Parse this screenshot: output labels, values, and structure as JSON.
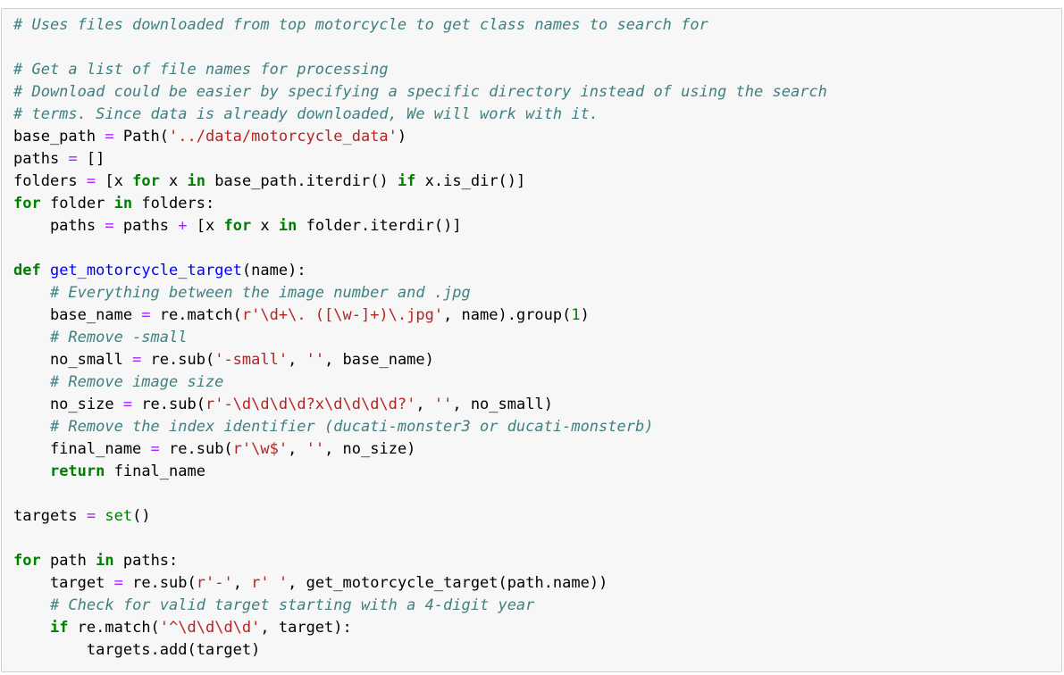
{
  "cell": {
    "lines": [
      [
        {
          "t": "cm",
          "v": "# Uses files downloaded from top motorcycle to get class names to search for"
        }
      ],
      [],
      [
        {
          "t": "cm",
          "v": "# Get a list of file names for processing"
        }
      ],
      [
        {
          "t": "cm",
          "v": "# Download could be easier by specifying a specific directory instead of using the search"
        }
      ],
      [
        {
          "t": "cm",
          "v": "# terms. Since data is already downloaded, We will work with it."
        }
      ],
      [
        {
          "t": "",
          "v": "base_path "
        },
        {
          "t": "op",
          "v": "="
        },
        {
          "t": "",
          "v": " Path("
        },
        {
          "t": "st",
          "v": "'../data/motorcycle_data'"
        },
        {
          "t": "",
          "v": ")"
        }
      ],
      [
        {
          "t": "",
          "v": "paths "
        },
        {
          "t": "op",
          "v": "="
        },
        {
          "t": "",
          "v": " []"
        }
      ],
      [
        {
          "t": "",
          "v": "folders "
        },
        {
          "t": "op",
          "v": "="
        },
        {
          "t": "",
          "v": " [x "
        },
        {
          "t": "kw",
          "v": "for"
        },
        {
          "t": "",
          "v": " x "
        },
        {
          "t": "kw",
          "v": "in"
        },
        {
          "t": "",
          "v": " base_path.iterdir() "
        },
        {
          "t": "kw",
          "v": "if"
        },
        {
          "t": "",
          "v": " x.is_dir()]"
        }
      ],
      [
        {
          "t": "kw",
          "v": "for"
        },
        {
          "t": "",
          "v": " folder "
        },
        {
          "t": "kw",
          "v": "in"
        },
        {
          "t": "",
          "v": " folders:"
        }
      ],
      [
        {
          "t": "",
          "v": "    paths "
        },
        {
          "t": "op",
          "v": "="
        },
        {
          "t": "",
          "v": " paths "
        },
        {
          "t": "op",
          "v": "+"
        },
        {
          "t": "",
          "v": " [x "
        },
        {
          "t": "kw",
          "v": "for"
        },
        {
          "t": "",
          "v": " x "
        },
        {
          "t": "kw",
          "v": "in"
        },
        {
          "t": "",
          "v": " folder.iterdir()]"
        }
      ],
      [],
      [
        {
          "t": "kw",
          "v": "def"
        },
        {
          "t": "",
          "v": " "
        },
        {
          "t": "fn",
          "v": "get_motorcycle_target"
        },
        {
          "t": "",
          "v": "(name):"
        }
      ],
      [
        {
          "t": "",
          "v": "    "
        },
        {
          "t": "cm",
          "v": "# Everything between the image number and .jpg"
        }
      ],
      [
        {
          "t": "",
          "v": "    base_name "
        },
        {
          "t": "op",
          "v": "="
        },
        {
          "t": "",
          "v": " re.match("
        },
        {
          "t": "st",
          "v": "r'\\d+\\. ([\\w-]+)\\.jpg'"
        },
        {
          "t": "",
          "v": ", name).group("
        },
        {
          "t": "nm",
          "v": "1"
        },
        {
          "t": "",
          "v": ")"
        }
      ],
      [
        {
          "t": "",
          "v": "    "
        },
        {
          "t": "cm",
          "v": "# Remove -small"
        }
      ],
      [
        {
          "t": "",
          "v": "    no_small "
        },
        {
          "t": "op",
          "v": "="
        },
        {
          "t": "",
          "v": " re.sub("
        },
        {
          "t": "st",
          "v": "'-small'"
        },
        {
          "t": "",
          "v": ", "
        },
        {
          "t": "st",
          "v": "''"
        },
        {
          "t": "",
          "v": ", base_name)"
        }
      ],
      [
        {
          "t": "",
          "v": "    "
        },
        {
          "t": "cm",
          "v": "# Remove image size"
        }
      ],
      [
        {
          "t": "",
          "v": "    no_size "
        },
        {
          "t": "op",
          "v": "="
        },
        {
          "t": "",
          "v": " re.sub("
        },
        {
          "t": "st",
          "v": "r'-\\d\\d\\d\\d?x\\d\\d\\d\\d?'"
        },
        {
          "t": "",
          "v": ", "
        },
        {
          "t": "st",
          "v": "''"
        },
        {
          "t": "",
          "v": ", no_small)"
        }
      ],
      [
        {
          "t": "",
          "v": "    "
        },
        {
          "t": "cm",
          "v": "# Remove the index identifier (ducati-monster3 or ducati-monsterb)"
        }
      ],
      [
        {
          "t": "",
          "v": "    final_name "
        },
        {
          "t": "op",
          "v": "="
        },
        {
          "t": "",
          "v": " re.sub("
        },
        {
          "t": "st",
          "v": "r'\\w$'"
        },
        {
          "t": "",
          "v": ", "
        },
        {
          "t": "st",
          "v": "''"
        },
        {
          "t": "",
          "v": ", no_size)"
        }
      ],
      [
        {
          "t": "",
          "v": "    "
        },
        {
          "t": "kw",
          "v": "return"
        },
        {
          "t": "",
          "v": " final_name"
        }
      ],
      [],
      [
        {
          "t": "",
          "v": "targets "
        },
        {
          "t": "op",
          "v": "="
        },
        {
          "t": "",
          "v": " "
        },
        {
          "t": "bi",
          "v": "set"
        },
        {
          "t": "",
          "v": "()"
        }
      ],
      [],
      [
        {
          "t": "kw",
          "v": "for"
        },
        {
          "t": "",
          "v": " path "
        },
        {
          "t": "kw",
          "v": "in"
        },
        {
          "t": "",
          "v": " paths:"
        }
      ],
      [
        {
          "t": "",
          "v": "    target "
        },
        {
          "t": "op",
          "v": "="
        },
        {
          "t": "",
          "v": " re.sub("
        },
        {
          "t": "st",
          "v": "r'-'"
        },
        {
          "t": "",
          "v": ", "
        },
        {
          "t": "st",
          "v": "r' '"
        },
        {
          "t": "",
          "v": ", get_motorcycle_target(path.name))"
        }
      ],
      [
        {
          "t": "",
          "v": "    "
        },
        {
          "t": "cm",
          "v": "# Check for valid target starting with a 4-digit year"
        }
      ],
      [
        {
          "t": "",
          "v": "    "
        },
        {
          "t": "kw",
          "v": "if"
        },
        {
          "t": "",
          "v": " re.match("
        },
        {
          "t": "st",
          "v": "'^\\d\\d\\d\\d'"
        },
        {
          "t": "",
          "v": ", target):"
        }
      ],
      [
        {
          "t": "",
          "v": "        targets.add(target)"
        }
      ]
    ]
  },
  "colors": {
    "background": "#f7f7f7",
    "border": "#cfcfcf",
    "comment": "#408080",
    "keyword": "#008000",
    "operator": "#aa22ff",
    "string": "#ba2121",
    "function_name": "#0000ff",
    "number": "#008000"
  }
}
